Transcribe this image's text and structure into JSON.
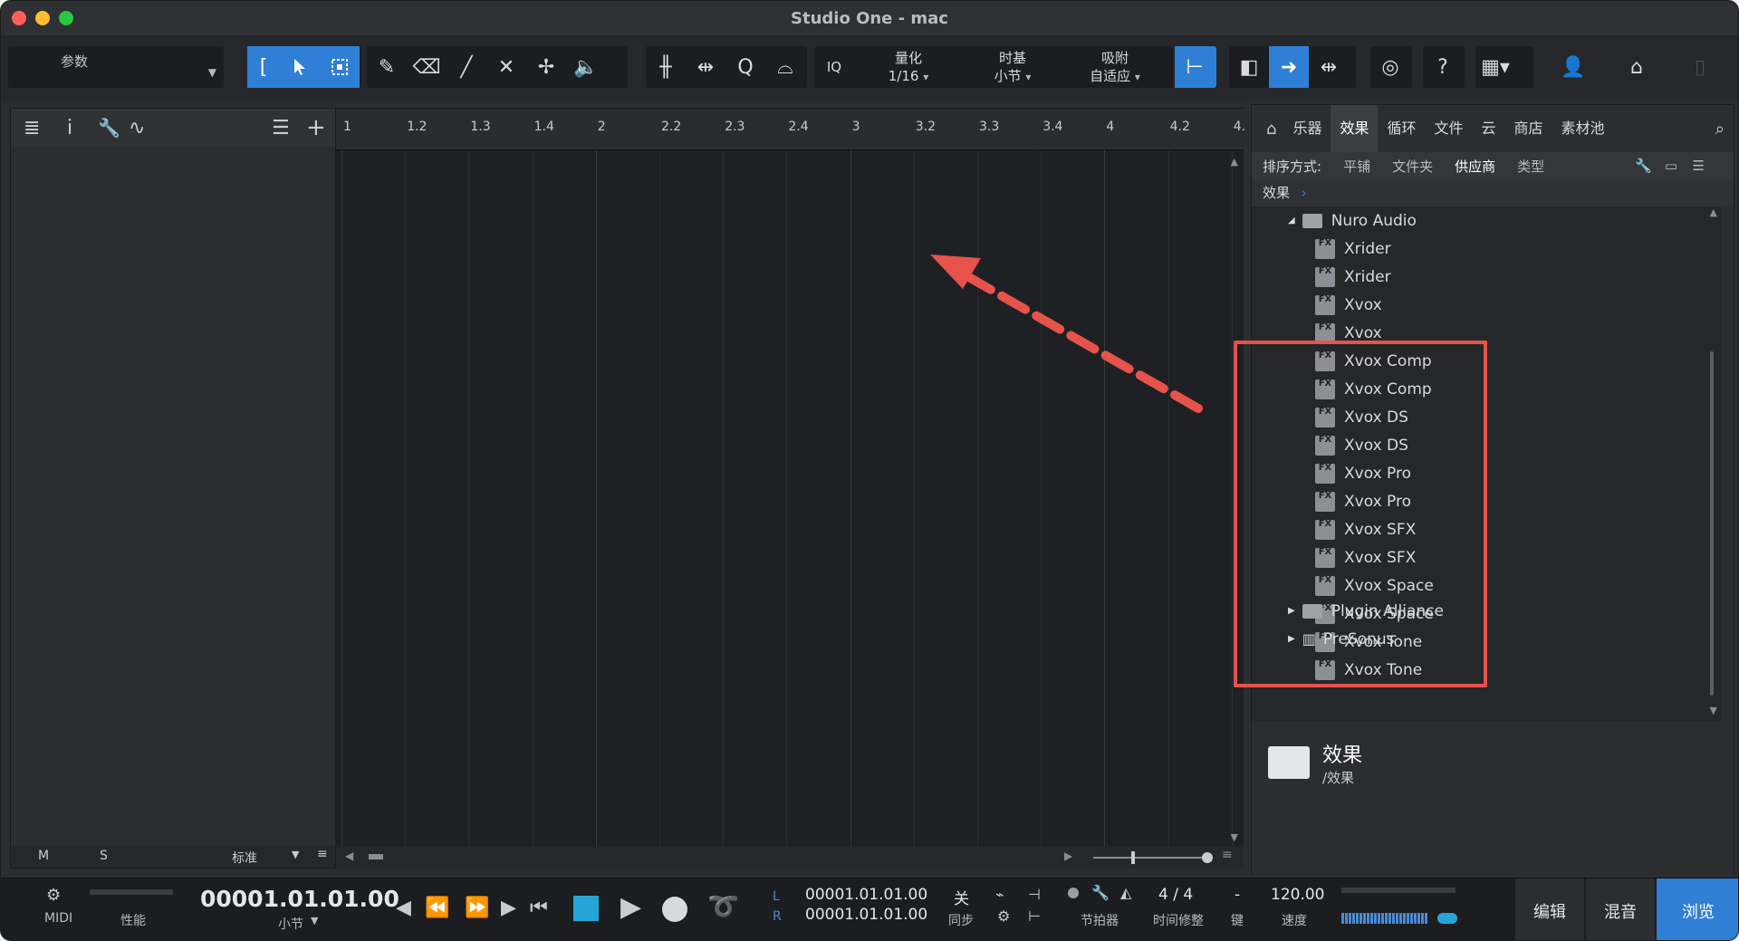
{
  "window": {
    "title": "Studio One - mac"
  },
  "toolbar": {
    "param_label": "参数",
    "quantize_label": "量化",
    "quantize_value": "1/16",
    "timebase_label": "时基",
    "timebase_value": "小节",
    "snap_label": "吸附",
    "snap_value": "自适应",
    "iq_label": "IQ",
    "help_label": "?"
  },
  "left_panel": {
    "bottom_m": "M",
    "bottom_s": "S",
    "bottom_std": "标准"
  },
  "ruler": {
    "labels": [
      "1",
      "1.2",
      "1.3",
      "1.4",
      "2",
      "2.2",
      "2.3",
      "2.4",
      "3",
      "3.2",
      "3.3",
      "3.4",
      "4",
      "4.2",
      "4."
    ]
  },
  "browser": {
    "tabs": [
      "乐器",
      "效果",
      "循环",
      "文件",
      "云",
      "商店",
      "素材池"
    ],
    "active_tab": "效果",
    "sort_label": "排序方式:",
    "sort_options": [
      "平铺",
      "文件夹",
      "供应商",
      "类型"
    ],
    "breadcrumb": "效果",
    "vendor": "Nuro Audio",
    "items": [
      "Xrider",
      "Xrider",
      "Xvox",
      "Xvox",
      "Xvox Comp",
      "Xvox Comp",
      "Xvox DS",
      "Xvox DS",
      "Xvox Pro",
      "Xvox Pro",
      "Xvox SFX",
      "Xvox SFX",
      "Xvox Space",
      "Xvox Space",
      "Xvox Tone",
      "Xvox Tone"
    ],
    "other_vendors": [
      "Plugin Alliance",
      "PreSonus"
    ],
    "footer_title": "效果",
    "footer_path": "/效果"
  },
  "transport": {
    "midi_label": "MIDI",
    "perf_label": "性能",
    "position": "00001.01.01.00",
    "position_unit": "小节",
    "loop_l": "00001.01.01.00",
    "loop_r": "00001.01.01.00",
    "l_label": "L",
    "r_label": "R",
    "sync_value": "关",
    "sync_label": "同步",
    "metronome_label": "节拍器",
    "time_sig": "4 / 4",
    "time_sig_label": "时间修整",
    "key_value": "-",
    "key_label": "键",
    "tempo": "120.00",
    "tempo_label": "速度"
  },
  "bottom_tabs": [
    "编辑",
    "混音",
    "浏览"
  ],
  "colors": {
    "accent": "#2f7fd6",
    "highlight": "#e5534b"
  }
}
